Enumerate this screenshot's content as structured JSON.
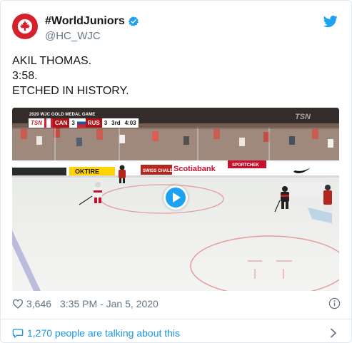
{
  "account": {
    "display_name": "#WorldJuniors",
    "handle": "@HC_WJC",
    "verified": true,
    "brand_color": "#d6202b"
  },
  "tweet": {
    "lines": [
      "AKIL THOMAS.",
      "3:58.",
      "ETCHED IN HISTORY."
    ]
  },
  "video": {
    "broadcast_title": "2020 WJC GOLD MEDAL GAME",
    "network": "TSN",
    "team_home": "CAN",
    "score_home": "3",
    "team_away": "RUS",
    "score_away": "3",
    "period": "3rd",
    "clock": "4:03",
    "boards_ads": [
      "OKTIRE",
      "SWISS CHALET",
      "Scotiabank",
      "SPORTCHEK"
    ],
    "play_icon": "play-icon"
  },
  "meta": {
    "likes": "3,646",
    "timestamp": "3:35 PM - Jan 5, 2020"
  },
  "conversation": {
    "label": "1,270 people are talking about this"
  },
  "colors": {
    "link": "#1b95e0",
    "twitter_blue": "#1da1f2",
    "muted": "#657786"
  }
}
